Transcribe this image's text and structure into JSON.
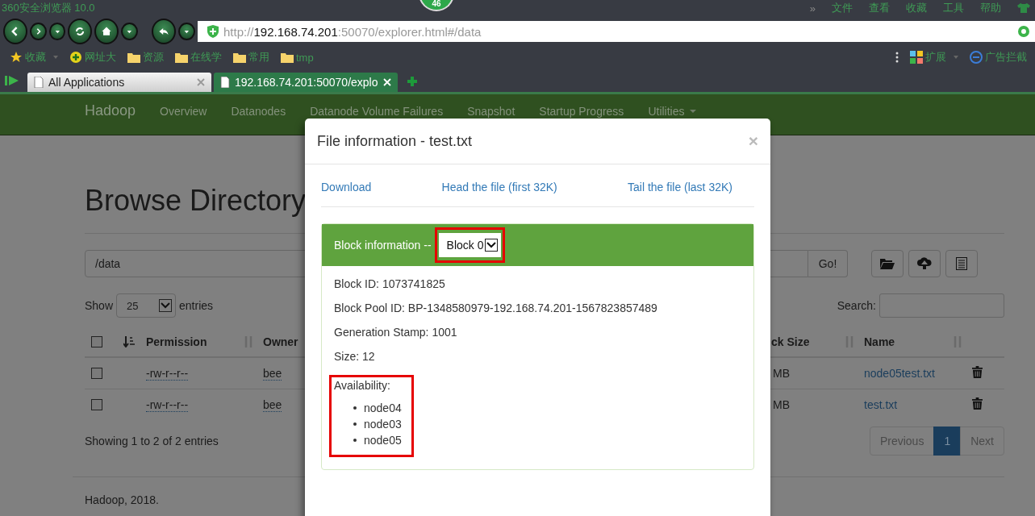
{
  "browser": {
    "title": "360安全浏览器 10.0",
    "badge": "46",
    "menu_overflow": "»",
    "menu": [
      "文件",
      "查看",
      "收藏",
      "工具",
      "帮助"
    ],
    "address": {
      "scheme": "http://",
      "host": "192.168.74.201",
      "rest": ":50070/explorer.html#/data"
    },
    "bookmarks": [
      {
        "kind": "star",
        "label": "收藏",
        "caret": true
      },
      {
        "kind": "site",
        "label": "网址大",
        "caret": false
      },
      {
        "kind": "folder",
        "label": "资源",
        "caret": false
      },
      {
        "kind": "folder",
        "label": "在线学",
        "caret": false
      },
      {
        "kind": "folder",
        "label": "常用",
        "caret": false
      },
      {
        "kind": "folder",
        "label": "tmp",
        "caret": false
      }
    ],
    "extensions": [
      {
        "kind": "apps",
        "label": "扩展",
        "caret": true
      },
      {
        "kind": "block",
        "label": "广告拦截",
        "caret": false
      }
    ],
    "tabs": [
      {
        "label": "All Applications",
        "selected": false
      },
      {
        "label": "192.168.74.201:50070/explo",
        "selected": true
      }
    ]
  },
  "navbar": {
    "brand": "Hadoop",
    "items": [
      {
        "label": "Overview",
        "dropdown": false
      },
      {
        "label": "Datanodes",
        "dropdown": false
      },
      {
        "label": "Datanode Volume Failures",
        "dropdown": false
      },
      {
        "label": "Snapshot",
        "dropdown": false
      },
      {
        "label": "Startup Progress",
        "dropdown": false
      },
      {
        "label": "Utilities",
        "dropdown": true
      }
    ]
  },
  "page": {
    "heading": "Browse Directory",
    "path": "/data",
    "go": "Go!",
    "show_label": "Show",
    "page_size": "25",
    "entries_label": "entries",
    "search_label": "Search:",
    "select_all_checked": false,
    "columns": {
      "left": [
        "Permission",
        "Owner"
      ],
      "right": [
        "ck Size",
        "Name"
      ]
    },
    "rows": [
      {
        "checked": false,
        "permission": "-rw-r--r--",
        "owner": "bee",
        "size": "MB",
        "name": "node05test.txt"
      },
      {
        "checked": false,
        "permission": "-rw-r--r--",
        "owner": "bee",
        "size": "MB",
        "name": "test.txt"
      }
    ],
    "summary": "Showing 1 to 2 of 2 entries",
    "pagination": [
      {
        "label": "Previous",
        "selected": false
      },
      {
        "label": "1",
        "selected": true
      },
      {
        "label": "Next",
        "selected": false
      }
    ],
    "footer": "Hadoop, 2018."
  },
  "modal": {
    "title": "File information - test.txt",
    "close": "×",
    "links": [
      "Download",
      "Head the file (first 32K)",
      "Tail the file (last 32K)"
    ],
    "panel_title": "Block information --",
    "block": "Block 0",
    "details": [
      "Block ID: 1073741825",
      "Block Pool ID: BP-1348580979-192.168.74.201-1567823857489",
      "Generation Stamp: 1001",
      "Size: 12"
    ],
    "availability_label": "Availability:",
    "nodes": [
      "node04",
      "node03",
      "node05"
    ]
  }
}
